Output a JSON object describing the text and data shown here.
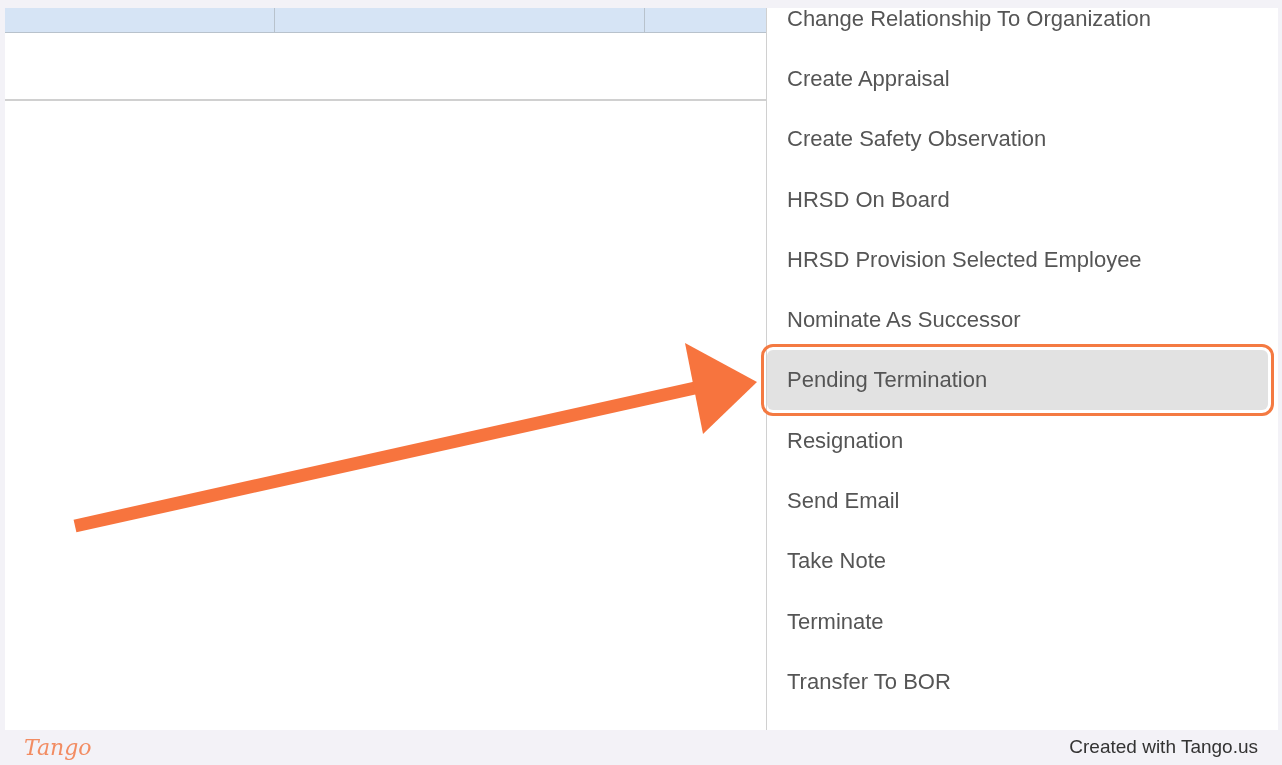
{
  "menu": {
    "items": [
      {
        "label": "Change Relationship To Organization",
        "selected": false
      },
      {
        "label": "Create Appraisal",
        "selected": false
      },
      {
        "label": "Create Safety Observation",
        "selected": false
      },
      {
        "label": "HRSD On Board",
        "selected": false
      },
      {
        "label": "HRSD Provision Selected Employee",
        "selected": false
      },
      {
        "label": "Nominate As Successor",
        "selected": false
      },
      {
        "label": "Pending Termination",
        "selected": true
      },
      {
        "label": "Resignation",
        "selected": false
      },
      {
        "label": "Send Email",
        "selected": false
      },
      {
        "label": "Take Note",
        "selected": false
      },
      {
        "label": "Terminate",
        "selected": false
      },
      {
        "label": "Transfer To BOR",
        "selected": false
      }
    ]
  },
  "footer": {
    "logo": "Tango",
    "credit": "Created with Tango.us"
  }
}
